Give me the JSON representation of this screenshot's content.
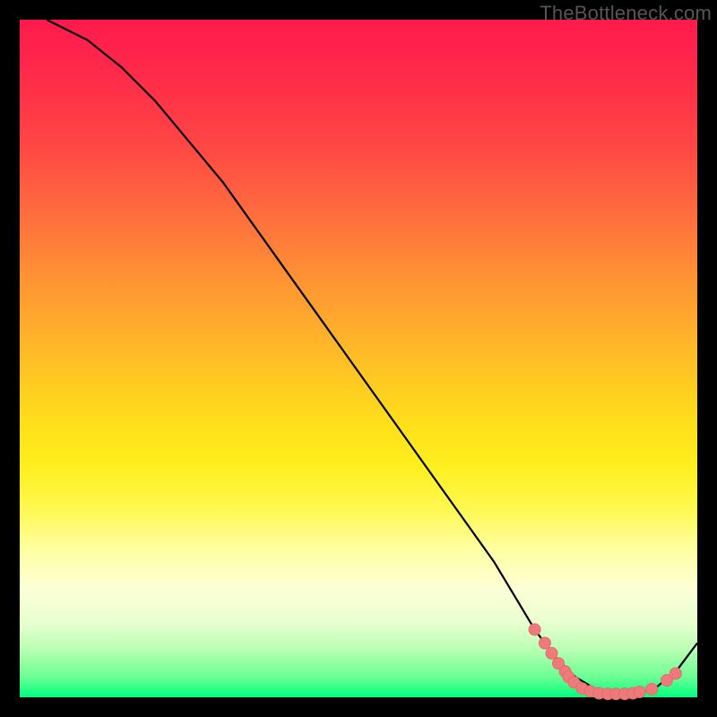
{
  "watermark": "TheBottleneck.com",
  "colors": {
    "curve": "#000000",
    "marker_fill": "#ed7b7b",
    "marker_stroke": "#e96a6a",
    "gradient_top": "#ff1a4d",
    "gradient_bottom": "#00ff80"
  },
  "chart_data": {
    "type": "line",
    "title": "",
    "xlabel": "",
    "ylabel": "",
    "xlim": [
      0,
      100
    ],
    "ylim": [
      0,
      100
    ],
    "grid": false,
    "series": [
      {
        "name": "curve",
        "x": [
          4,
          6,
          10,
          15,
          20,
          25,
          30,
          35,
          40,
          45,
          50,
          55,
          60,
          65,
          70,
          73,
          76,
          79,
          82,
          85,
          88,
          91,
          94,
          97,
          100
        ],
        "y": [
          100,
          99,
          97,
          93,
          88,
          82,
          76,
          69,
          62,
          55,
          48,
          41,
          34,
          27,
          20,
          15,
          10,
          6,
          3,
          1.2,
          0.5,
          0.5,
          1.5,
          4,
          8
        ]
      }
    ],
    "markers": [
      {
        "x": 76.0,
        "y": 10.0
      },
      {
        "x": 77.5,
        "y": 8.0
      },
      {
        "x": 78.5,
        "y": 6.5
      },
      {
        "x": 79.5,
        "y": 5.0
      },
      {
        "x": 80.5,
        "y": 3.8
      },
      {
        "x": 81.0,
        "y": 3.0
      },
      {
        "x": 81.8,
        "y": 2.2
      },
      {
        "x": 83.0,
        "y": 1.3
      },
      {
        "x": 84.2,
        "y": 0.9
      },
      {
        "x": 85.5,
        "y": 0.6
      },
      {
        "x": 86.8,
        "y": 0.5
      },
      {
        "x": 88.0,
        "y": 0.5
      },
      {
        "x": 89.3,
        "y": 0.5
      },
      {
        "x": 90.5,
        "y": 0.6
      },
      {
        "x": 91.5,
        "y": 0.8
      },
      {
        "x": 93.3,
        "y": 1.2
      },
      {
        "x": 95.5,
        "y": 2.5
      },
      {
        "x": 96.8,
        "y": 3.5
      }
    ]
  }
}
